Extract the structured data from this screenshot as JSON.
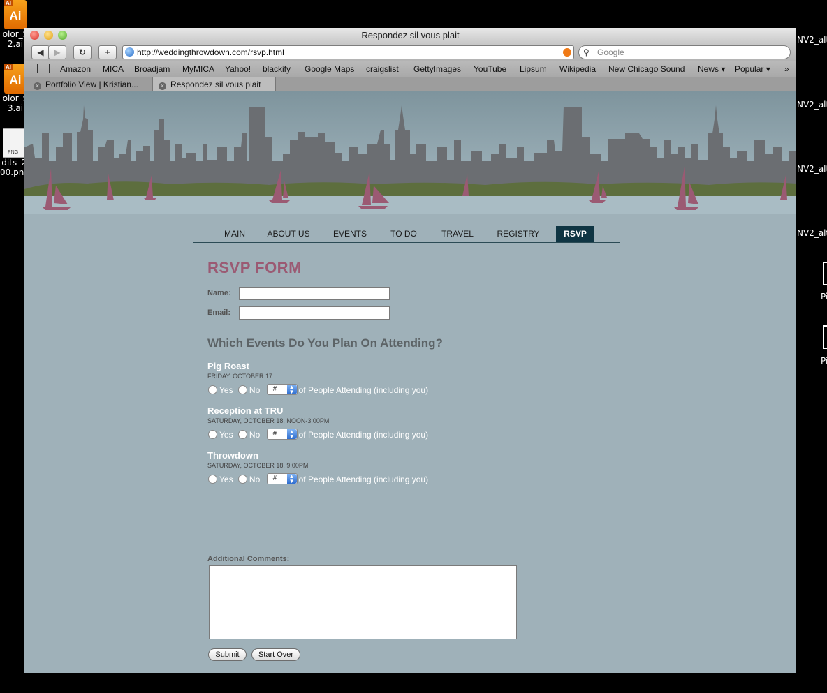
{
  "desktop": {
    "icons": [
      {
        "label_line1": "olor_S",
        "label_line2": "2.ai"
      },
      {
        "label_line1": "olor_S",
        "label_line2": "3.ai"
      },
      {
        "label_line1": "dits_2",
        "label_line2": "00.png"
      }
    ],
    "right_labels": [
      "NV2_alt",
      "NV2_alt",
      "NV2_alt",
      "NV2_alt",
      "Pi",
      "Pi"
    ],
    "ai_tag": "AI",
    "ai_text": "Ai",
    "png_tag": "PNG"
  },
  "browser": {
    "title": "Respondez sil vous plait",
    "url": "http://weddingthrowdown.com/rsvp.html",
    "search_placeholder": "Google",
    "buttons": {
      "back": "◀",
      "forward": "▶",
      "reload": "↻",
      "add": "+"
    },
    "bookmarks": [
      "Amazon",
      "MICA",
      "Broadjam",
      "MyMICA",
      "Yahoo!",
      "blackify",
      "Google Maps",
      "craigslist",
      "GettyImages",
      "YouTube",
      "Lipsum",
      "Wikipedia",
      "New Chicago Sound",
      "News ▾",
      "Popular ▾",
      "»"
    ],
    "tabs": [
      "Portfolio View | Kristian...",
      "Respondez sil vous plait"
    ]
  },
  "nav": [
    "MAIN",
    "ABOUT US",
    "EVENTS",
    "TO DO",
    "TRAVEL",
    "REGISTRY",
    "RSVP"
  ],
  "form": {
    "title": "RSVP FORM",
    "name_label": "Name:",
    "email_label": "Email:",
    "section_title": "Which Events Do You Plan On Attending?",
    "yes_label": "Yes",
    "no_label": "No",
    "select_value": "#",
    "attending_label": "of People Attending (including you)",
    "events": [
      {
        "name": "Pig Roast",
        "date": "FRIDAY, OCTOBER 17"
      },
      {
        "name": "Reception at TRU",
        "date": "SATURDAY, OCTOBER 18, NOON-3:00PM"
      },
      {
        "name": "Throwdown",
        "date": "SATURDAY, OCTOBER 18, 9:00PM"
      }
    ],
    "comments_label": "Additional Comments:",
    "submit_label": "Submit",
    "reset_label": "Start Over"
  },
  "colors": {
    "page_bg": "#9fb1b9",
    "accent": "#9b5a73",
    "nav_active": "#0f3543",
    "skyline": "#6b6e72",
    "sails": "#9b5a73",
    "trees": "#5d6e3e"
  }
}
